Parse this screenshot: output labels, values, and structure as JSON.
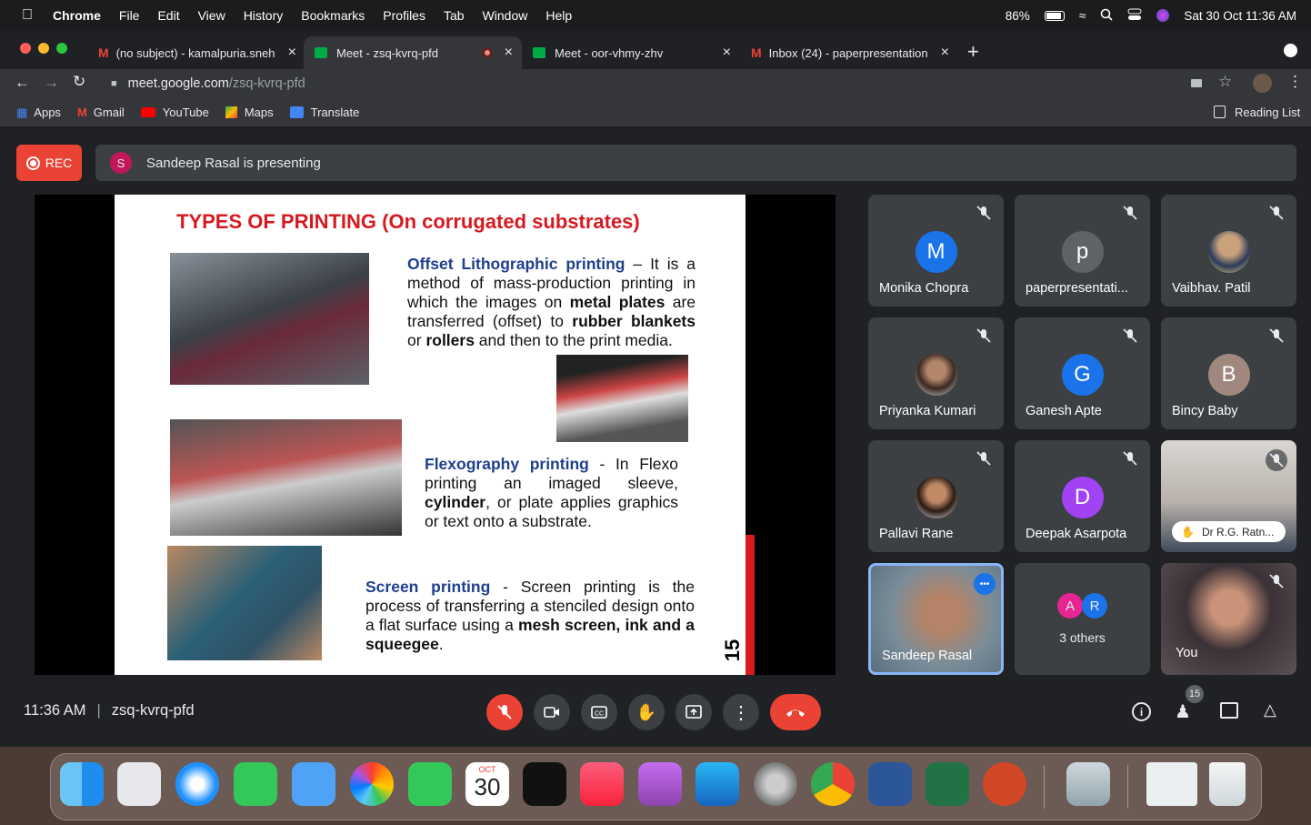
{
  "menubar": {
    "app": "Chrome",
    "items": [
      "File",
      "Edit",
      "View",
      "History",
      "Bookmarks",
      "Profiles",
      "Tab",
      "Window",
      "Help"
    ],
    "battery": "86%",
    "datetime": "Sat 30 Oct  11:36 AM"
  },
  "tabs": [
    {
      "title": "(no subject) - kamalpuria.sneh"
    },
    {
      "title": "Meet - zsq-kvrq-pfd"
    },
    {
      "title": "Meet - oor-vhmy-zhv"
    },
    {
      "title": "Inbox (24) - paperpresentation"
    }
  ],
  "address": {
    "domain": "meet.google.com",
    "path": "/zsq-kvrq-pfd"
  },
  "bookmarks": [
    {
      "label": "Apps"
    },
    {
      "label": "Gmail"
    },
    {
      "label": "YouTube"
    },
    {
      "label": "Maps"
    },
    {
      "label": "Translate"
    }
  ],
  "reading_list": "Reading List",
  "meet": {
    "rec": "REC",
    "presenter_initial": "S",
    "presenting": "Sandeep Rasal is presenting",
    "time": "11:36 AM",
    "code": "zsq-kvrq-pfd",
    "participant_count": "15"
  },
  "slide": {
    "title": "TYPES OF PRINTING (On corrugated substrates)",
    "offset_term": "Offset Lithographic printing",
    "offset_a": " – It is a method of mass-production printing in which the images on ",
    "offset_b": "metal plates",
    "offset_c": " are transferred (offset) to ",
    "offset_d": "rubber blankets",
    "offset_e": " or ",
    "offset_f": "rollers",
    "offset_g": " and then to the print media.",
    "flexo_term": "Flexography printing",
    "flexo_a": " - In Flexo printing an imaged sleeve, ",
    "flexo_b": "cylinder",
    "flexo_c": ", or plate applies graphics or text onto a substrate.",
    "screen_term": "Screen printing",
    "screen_a": " - Screen printing is the process of transferring a stenciled design onto a flat surface using a ",
    "screen_b": "mesh screen, ink and a squeegee",
    "screen_c": ".",
    "page": "15"
  },
  "participants": [
    {
      "name": "Monika Chopra",
      "initial": "M",
      "color": "#1a73e8"
    },
    {
      "name": "paperpresentati...",
      "initial": "p",
      "color": "#5f6368"
    },
    {
      "name": "Vaibhav. Patil",
      "initial": "",
      "color": "#8d6e63"
    },
    {
      "name": "Priyanka Kumari",
      "initial": "",
      "color": "#6d4c41"
    },
    {
      "name": "Ganesh Apte",
      "initial": "G",
      "color": "#1a73e8"
    },
    {
      "name": "Bincy Baby",
      "initial": "B",
      "color": "#a1887f"
    },
    {
      "name": "Pallavi Rane",
      "initial": "",
      "color": "#5d4037"
    },
    {
      "name": "Deepak Asarpota",
      "initial": "D",
      "color": "#a142f4"
    },
    {
      "name": "Dr R.G. Ratn...",
      "initial": "",
      "color": "#888"
    },
    {
      "name": "Sandeep Rasal",
      "initial": "",
      "color": "#777"
    },
    {
      "name": "3 others",
      "initial": "A",
      "initial2": "R",
      "color": "#e52592",
      "color2": "#1a73e8"
    },
    {
      "name": "You",
      "initial": "",
      "color": "#555"
    }
  ],
  "dock": {
    "calendar_month": "OCT",
    "calendar_day": "30"
  }
}
